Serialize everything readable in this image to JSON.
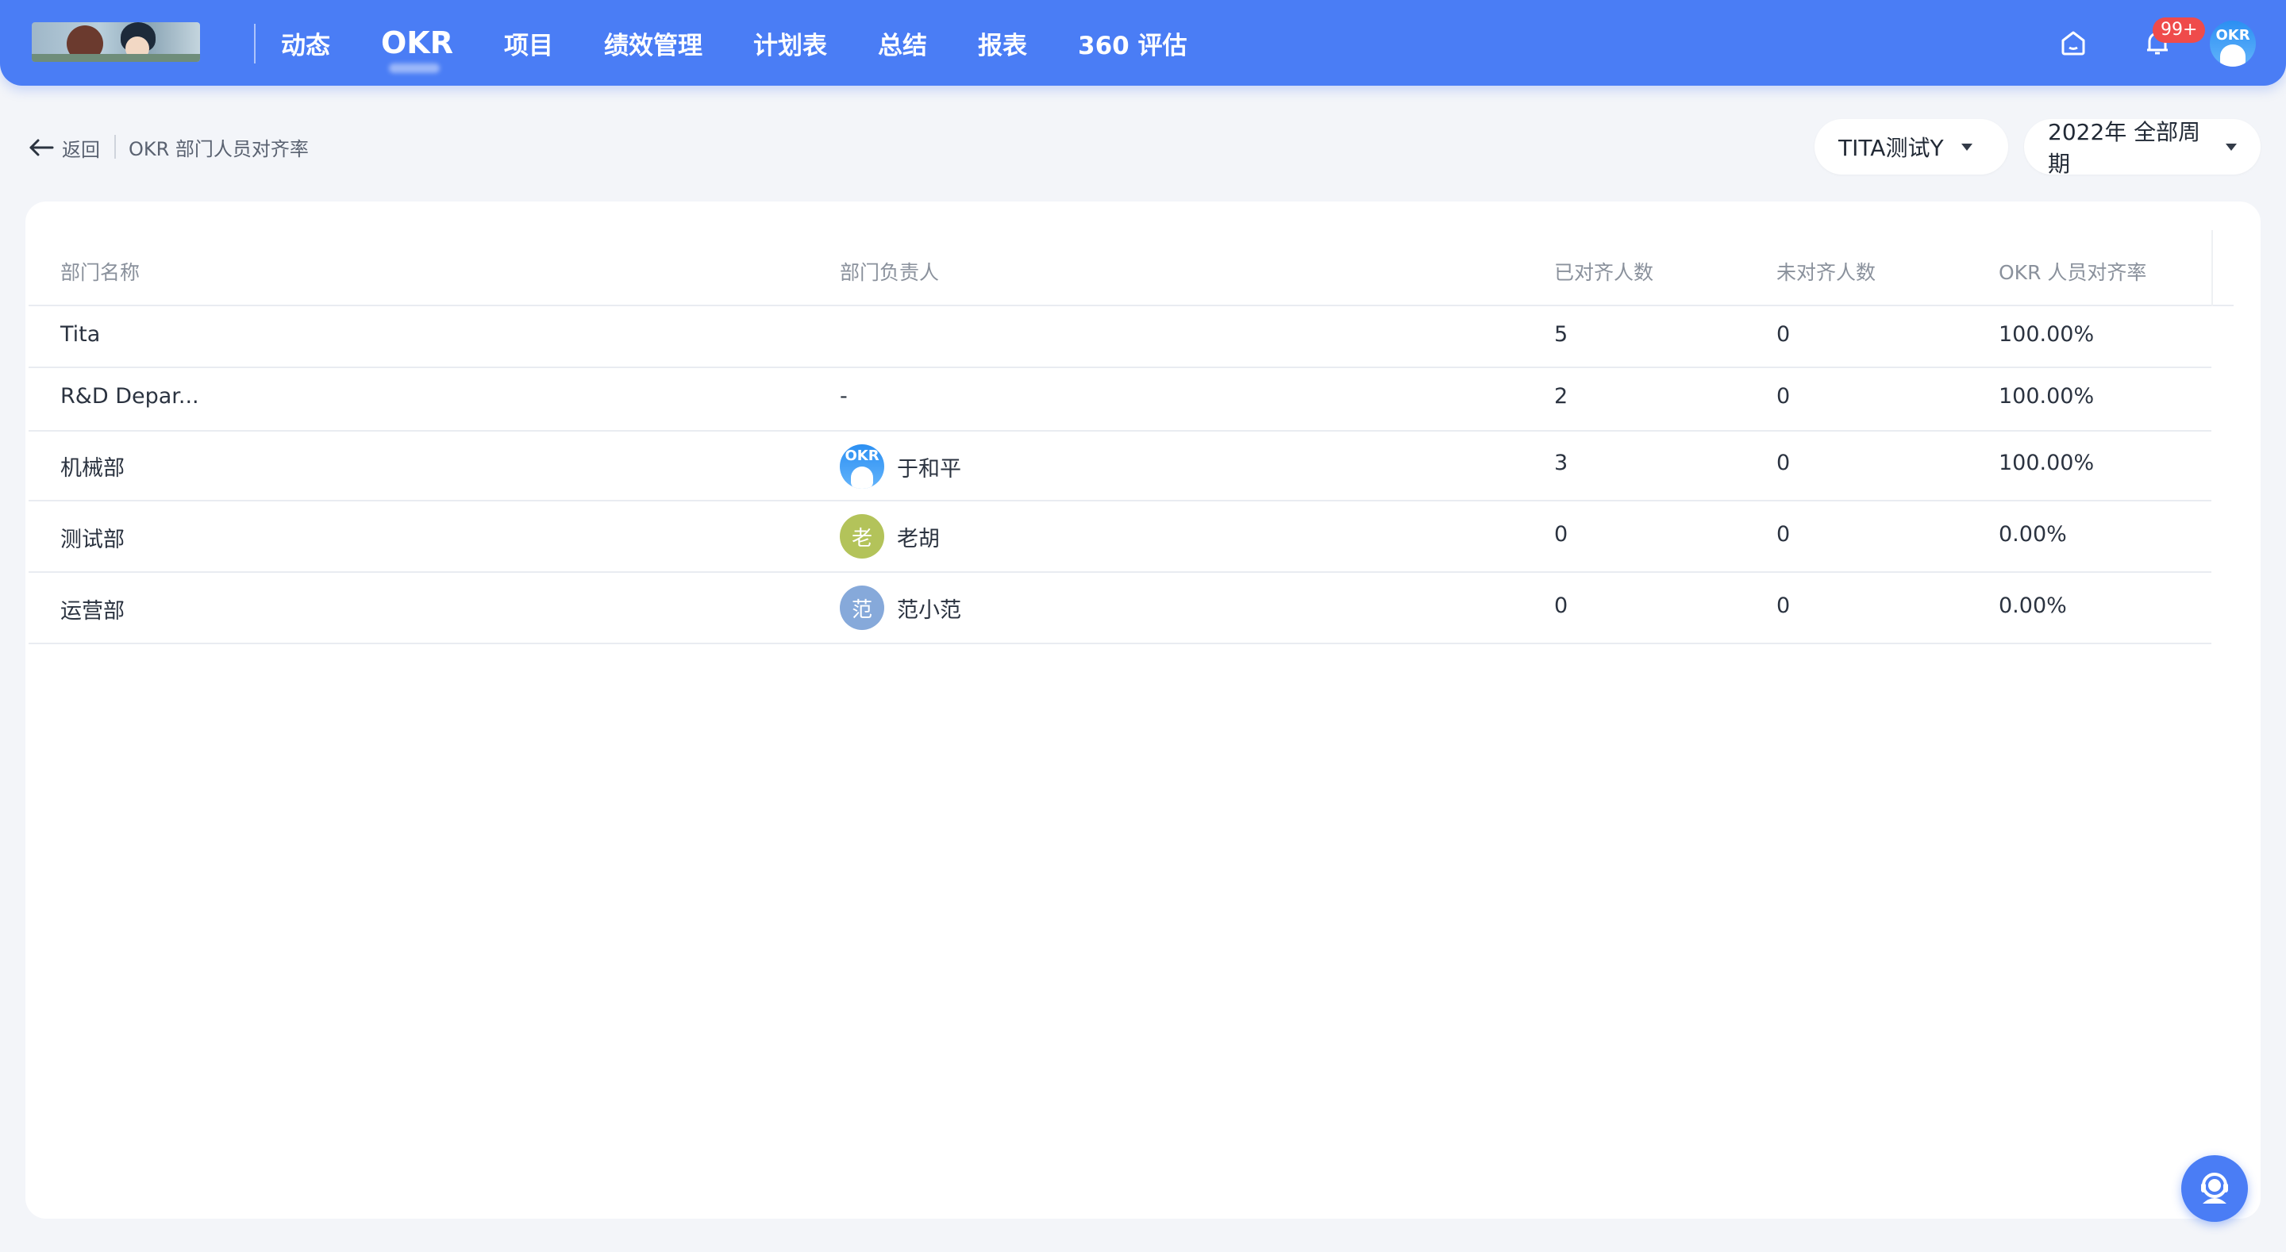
{
  "nav": {
    "items": [
      "动态",
      "OKR",
      "项目",
      "绩效管理",
      "计划表",
      "总结",
      "报表",
      "360 评估"
    ],
    "active": "OKR"
  },
  "top_right": {
    "home_icon": "home-icon",
    "notification_icon": "bell-icon",
    "notification_badge": "99+",
    "avatar_text": "OKR"
  },
  "breadcrumb": {
    "back_label": "返回",
    "page_title": "OKR 部门人员对齐率"
  },
  "filters": {
    "user_select": "TITA测试Y",
    "period_select": "2022年 全部周期"
  },
  "table": {
    "headers": [
      "部门名称",
      "部门负责人",
      "已对齐人数",
      "未对齐人数",
      "OKR 人员对齐率"
    ],
    "rows": [
      {
        "dept": "Tita",
        "owner": "",
        "avatar": "",
        "avatar_color": "",
        "aligned": "5",
        "unaligned": "0",
        "rate": "100.00%"
      },
      {
        "dept": "R&D Depar...",
        "owner": "-",
        "avatar": "",
        "avatar_color": "",
        "aligned": "2",
        "unaligned": "0",
        "rate": "100.00%"
      },
      {
        "dept": "机械部",
        "owner": "于和平",
        "avatar": "OKR",
        "avatar_color": "#2b8ff2",
        "aligned": "3",
        "unaligned": "0",
        "rate": "100.00%"
      },
      {
        "dept": "测试部",
        "owner": "老胡",
        "avatar": "老",
        "avatar_color": "#b3c35a",
        "aligned": "0",
        "unaligned": "0",
        "rate": "0.00%"
      },
      {
        "dept": "运营部",
        "owner": "范小范",
        "avatar": "范",
        "avatar_color": "#86a9da",
        "aligned": "0",
        "unaligned": "0",
        "rate": "0.00%"
      }
    ]
  },
  "colors": {
    "primary": "#4a7df5",
    "badge": "#ef4b4b",
    "page_bg": "#f3f5f9"
  },
  "help_icon": "customer-service-icon"
}
